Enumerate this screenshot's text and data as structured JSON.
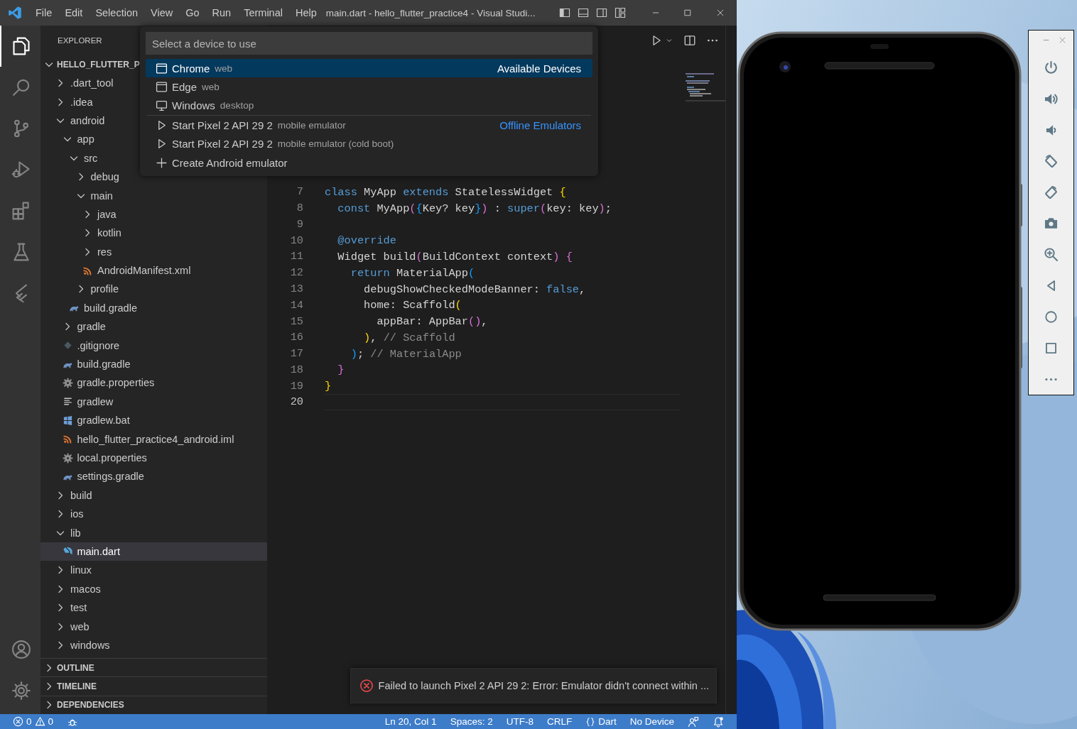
{
  "window": {
    "title": "main.dart - hello_flutter_practice4 - Visual Studi..."
  },
  "menu": [
    "File",
    "Edit",
    "Selection",
    "View",
    "Go",
    "Run",
    "Terminal",
    "Help"
  ],
  "activity_bar": {
    "top": [
      {
        "selected": true
      },
      {
        "selected": false
      },
      {
        "selected": false
      },
      {
        "selected": false
      },
      {
        "selected": false
      },
      {
        "selected": false
      },
      {
        "selected": false
      }
    ],
    "bottom": [
      {
        "selected": false
      },
      {
        "selected": false
      }
    ]
  },
  "explorer": {
    "title": "EXPLORER",
    "root": {
      "label": "HELLO_FLUTTER_P",
      "expanded": true,
      "children": [
        {
          "label": ".dart_tool",
          "kind": "folder",
          "expanded": false,
          "selected": false
        },
        {
          "label": ".idea",
          "kind": "folder",
          "expanded": false,
          "selected": false
        },
        {
          "label": "android",
          "kind": "folder",
          "expanded": true,
          "selected": false,
          "children": [
            {
              "label": "app",
              "kind": "folder",
              "expanded": true,
              "selected": false,
              "children": [
                {
                  "label": "src",
                  "kind": "folder",
                  "expanded": true,
                  "selected": false,
                  "children": [
                    {
                      "label": "debug",
                      "kind": "folder",
                      "expanded": false,
                      "selected": false
                    },
                    {
                      "label": "main",
                      "kind": "folder",
                      "expanded": true,
                      "selected": false,
                      "children": [
                        {
                          "label": "java",
                          "kind": "folder",
                          "expanded": false,
                          "selected": false
                        },
                        {
                          "label": "kotlin",
                          "kind": "folder",
                          "expanded": false,
                          "selected": false
                        },
                        {
                          "label": "res",
                          "kind": "folder",
                          "expanded": false,
                          "selected": false
                        },
                        {
                          "label": "AndroidManifest.xml",
                          "kind": "xml",
                          "selected": false
                        }
                      ]
                    },
                    {
                      "label": "profile",
                      "kind": "folder",
                      "expanded": false,
                      "selected": false
                    }
                  ]
                },
                {
                  "label": "build.gradle",
                  "kind": "gradle",
                  "selected": false
                }
              ]
            },
            {
              "label": "gradle",
              "kind": "folder",
              "expanded": false,
              "selected": false
            },
            {
              "label": ".gitignore",
              "kind": "git",
              "selected": false
            },
            {
              "label": "build.gradle",
              "kind": "gradle",
              "selected": false
            },
            {
              "label": "gradle.properties",
              "kind": "config",
              "selected": false
            },
            {
              "label": "gradlew",
              "kind": "script",
              "selected": false
            },
            {
              "label": "gradlew.bat",
              "kind": "batch",
              "selected": false
            },
            {
              "label": "hello_flutter_practice4_android.iml",
              "kind": "xml",
              "selected": false
            },
            {
              "label": "local.properties",
              "kind": "config",
              "selected": false
            },
            {
              "label": "settings.gradle",
              "kind": "gradle",
              "selected": false
            }
          ]
        },
        {
          "label": "build",
          "kind": "folder",
          "expanded": false,
          "selected": false
        },
        {
          "label": "ios",
          "kind": "folder",
          "expanded": false,
          "selected": false
        },
        {
          "label": "lib",
          "kind": "folder",
          "expanded": true,
          "selected": false,
          "children": [
            {
              "label": "main.dart",
              "kind": "dart",
              "selected": true
            }
          ]
        },
        {
          "label": "linux",
          "kind": "folder",
          "expanded": false,
          "selected": false
        },
        {
          "label": "macos",
          "kind": "folder",
          "expanded": false,
          "selected": false
        },
        {
          "label": "test",
          "kind": "folder",
          "expanded": false,
          "selected": false
        },
        {
          "label": "web",
          "kind": "folder",
          "expanded": false,
          "selected": false
        },
        {
          "label": "windows",
          "kind": "folder",
          "expanded": false,
          "selected": false
        }
      ]
    },
    "sections": [
      {
        "label": "OUTLINE",
        "expanded": false
      },
      {
        "label": "TIMELINE",
        "expanded": false
      },
      {
        "label": "DEPENDENCIES",
        "expanded": false
      }
    ]
  },
  "editor": {
    "lines": [
      {
        "number": "7",
        "current": false,
        "tokens": [
          {
            "text": "class ",
            "kind": "keyword"
          },
          {
            "text": "MyApp ",
            "kind": "plain"
          },
          {
            "text": "extends ",
            "kind": "keyword"
          },
          {
            "text": "StatelessWidget ",
            "kind": "plain"
          },
          {
            "text": "{",
            "kind": "bracket1"
          }
        ]
      },
      {
        "number": "8",
        "current": false,
        "tokens": [
          {
            "text": "  const ",
            "kind": "keyword"
          },
          {
            "text": "MyApp",
            "kind": "plain"
          },
          {
            "text": "(",
            "kind": "bracket2"
          },
          {
            "text": "{",
            "kind": "bracket3"
          },
          {
            "text": "Key? key",
            "kind": "plain"
          },
          {
            "text": "}",
            "kind": "bracket3"
          },
          {
            "text": ")",
            "kind": "bracket2"
          },
          {
            "text": " : ",
            "kind": "plain"
          },
          {
            "text": "super",
            "kind": "keyword"
          },
          {
            "text": "(",
            "kind": "bracket2"
          },
          {
            "text": "key: key",
            "kind": "plain"
          },
          {
            "text": ")",
            "kind": "bracket2"
          },
          {
            "text": ";",
            "kind": "plain"
          }
        ]
      },
      {
        "number": "9",
        "current": false
      },
      {
        "number": "10",
        "current": false,
        "tokens": [
          {
            "text": "  @override",
            "kind": "keyword"
          }
        ]
      },
      {
        "number": "11",
        "current": false,
        "tokens": [
          {
            "text": "  Widget build",
            "kind": "plain"
          },
          {
            "text": "(",
            "kind": "bracket2"
          },
          {
            "text": "BuildContext context",
            "kind": "plain"
          },
          {
            "text": ") {",
            "kind": "bracket2"
          }
        ]
      },
      {
        "number": "12",
        "current": false,
        "tokens": [
          {
            "text": "    return ",
            "kind": "keyword"
          },
          {
            "text": "MaterialApp",
            "kind": "plain"
          },
          {
            "text": "(",
            "kind": "bracket3"
          }
        ]
      },
      {
        "number": "13",
        "current": false,
        "tokens": [
          {
            "text": "      debugShowCheckedModeBanner: ",
            "kind": "plain"
          },
          {
            "text": "false",
            "kind": "keyword"
          },
          {
            "text": ",",
            "kind": "plain"
          }
        ]
      },
      {
        "number": "14",
        "current": false,
        "tokens": [
          {
            "text": "      home: Scaffold",
            "kind": "plain"
          },
          {
            "text": "(",
            "kind": "bracket1"
          }
        ]
      },
      {
        "number": "15",
        "current": false,
        "tokens": [
          {
            "text": "        appBar: AppBar",
            "kind": "plain"
          },
          {
            "text": "()",
            "kind": "bracket2"
          },
          {
            "text": ",",
            "kind": "plain"
          }
        ]
      },
      {
        "number": "16",
        "current": false,
        "tokens": [
          {
            "text": "      )",
            "kind": "bracket1"
          },
          {
            "text": ", ",
            "kind": "plain"
          },
          {
            "text": "// Scaffold",
            "kind": "comment"
          }
        ]
      },
      {
        "number": "17",
        "current": false,
        "tokens": [
          {
            "text": "    )",
            "kind": "bracket3"
          },
          {
            "text": "; ",
            "kind": "plain"
          },
          {
            "text": "// MaterialApp",
            "kind": "comment"
          }
        ]
      },
      {
        "number": "18",
        "current": false,
        "tokens": [
          {
            "text": "  }",
            "kind": "bracket2"
          }
        ]
      },
      {
        "number": "19",
        "current": false,
        "tokens": [
          {
            "text": "}",
            "kind": "bracket1"
          }
        ]
      },
      {
        "number": "20",
        "current": true
      }
    ]
  },
  "quick_pick": {
    "placeholder": "Select a device to use",
    "items": [
      {
        "kind": "browser",
        "label": "Chrome",
        "detail": "web",
        "group": "Available Devices",
        "selected": true
      },
      {
        "kind": "browser",
        "label": "Edge",
        "detail": "web",
        "selected": false
      },
      {
        "kind": "desktop",
        "label": "Windows",
        "detail": "desktop",
        "selected": false
      },
      {
        "kind": "emulator",
        "label": "Start Pixel 2 API 29 2",
        "detail": "mobile emulator",
        "group": "Offline Emulators",
        "selected": false
      },
      {
        "kind": "emulator",
        "label": "Start Pixel 2 API 29 2",
        "detail": "mobile emulator (cold boot)",
        "selected": false
      },
      {
        "kind": "create",
        "label": "Create Android emulator",
        "selected": false
      }
    ]
  },
  "notification": {
    "kind": "error",
    "message": "Failed to launch Pixel 2 API 29 2: Error: Emulator didn't connect within ..."
  },
  "status_bar": {
    "errors": "0",
    "warnings": "0",
    "items": [
      {
        "label": "Ln 20, Col 1"
      },
      {
        "label": "Spaces: 2"
      },
      {
        "label": "UTF-8"
      },
      {
        "label": "CRLF"
      },
      {
        "kind": "language",
        "label": "Dart"
      },
      {
        "label": "No Device"
      }
    ]
  }
}
